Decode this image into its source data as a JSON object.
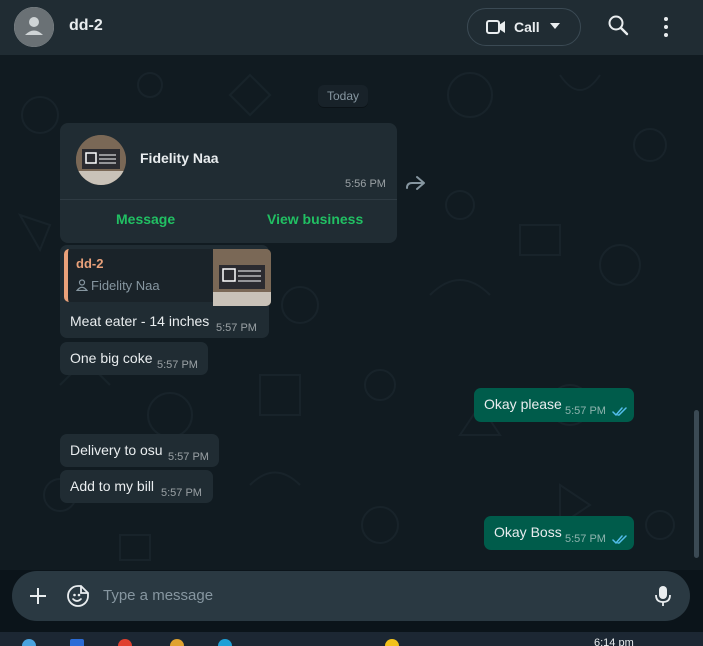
{
  "header": {
    "chat_name": "dd-2",
    "call_label": "Call",
    "icons": [
      "avatar-icon",
      "video-camera-icon",
      "chevron-down-icon",
      "search-icon",
      "more-vert-icon"
    ]
  },
  "chat": {
    "day_chip": "Today",
    "business_card": {
      "name": "Fidelity Naa",
      "time": "5:56 PM",
      "message_button": "Message",
      "view_business_button": "View business"
    },
    "reply_quote": {
      "name": "dd-2",
      "subtitle": "Fidelity Naa"
    },
    "messages": [
      {
        "direction": "in",
        "text": "Meat eater - 14 inches",
        "time": "5:57 PM"
      },
      {
        "direction": "in",
        "text": "One big coke",
        "time": "5:57 PM"
      },
      {
        "direction": "out",
        "text": "Okay please",
        "time": "5:57 PM",
        "status": "read"
      },
      {
        "direction": "in",
        "text": "Delivery to osu",
        "time": "5:57 PM"
      },
      {
        "direction": "in",
        "text": "Add to my bill",
        "time": "5:57 PM"
      },
      {
        "direction": "out",
        "text": "Okay Boss",
        "time": "5:57 PM",
        "status": "read"
      }
    ]
  },
  "composer": {
    "placeholder": "Type a message"
  },
  "taskbar": {
    "clock": "6:14 pm"
  },
  "colors": {
    "header_bg": "#202c33",
    "chat_bg": "#111b21",
    "incoming_bubble": "#202c33",
    "outgoing_bubble": "#005c4b",
    "accent_green": "#21c063",
    "read_ticks": "#53bdeb",
    "quote_accent": "#e9a17a"
  }
}
